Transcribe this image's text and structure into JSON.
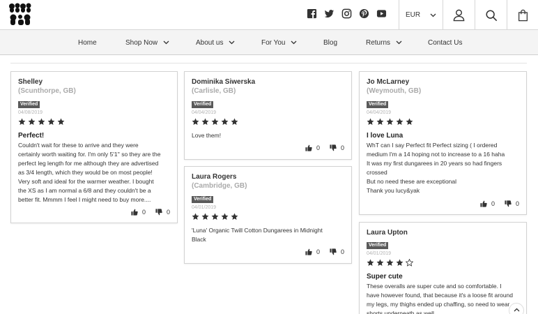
{
  "brand": {
    "logo_text": "lucy & yak"
  },
  "header": {
    "social": [
      "facebook-icon",
      "twitter-icon",
      "instagram-icon",
      "pinterest-icon",
      "youtube-icon"
    ],
    "currency": "EUR"
  },
  "nav": {
    "items": [
      {
        "label": "Home",
        "dropdown": false
      },
      {
        "label": "Shop Now",
        "dropdown": true
      },
      {
        "label": "About us",
        "dropdown": true
      },
      {
        "label": "For You",
        "dropdown": true
      },
      {
        "label": "Blog",
        "dropdown": false
      },
      {
        "label": "Returns",
        "dropdown": true
      },
      {
        "label": "Contact Us",
        "dropdown": false
      }
    ]
  },
  "verified_label": "Verified",
  "reviews": [
    {
      "name": "Shelley",
      "location": "(Scunthorpe, GB)",
      "date": "04/08/2019",
      "rating": 5,
      "title": "Perfect!",
      "body": "Couldn't wait for these to arrive and they were\ncertainly worth waiting for. I'm only 5'1'' so they are the\nperfect leg length for me although they are advertised\nas 3/4 length, which they would be on most people!\nVery soft and ideal for the warmer weather. I bought\nthe XS as I am normal a 6/8 and they couldn't be a\nbetter fit. Mmmm I feel I might need to buy more....",
      "helpful_yes": "0",
      "helpful_no": "0"
    },
    {
      "name": "Dominika Siwerska",
      "location": "(Carlisle, GB)",
      "date": "04/04/2019",
      "rating": 5,
      "title": "",
      "body": "Love them!",
      "helpful_yes": "0",
      "helpful_no": "0"
    },
    {
      "name": "Laura Rogers",
      "location": "(Cambridge, GB)",
      "date": "04/01/2019",
      "rating": 5,
      "title": "",
      "body": "'Luna' Organic Twill Cotton Dungarees in Midnight\nBlack",
      "helpful_yes": "0",
      "helpful_no": "0"
    },
    {
      "name": "Jo McLarney",
      "location": "(Weymouth, GB)",
      "date": "04/04/2019",
      "rating": 5,
      "title": "I love Luna",
      "body": "WhT can I say Perfect fit Perfect sizing ( I ordered\nmedium I'm a 14 hoping not to increase to a 16 haha\nIt was my first dungarees in 20 years so had fingers\ncrossed\nBut no need these are exceptional\nThank you lucy&yak",
      "helpful_yes": "0",
      "helpful_no": "0"
    },
    {
      "name": "Laura Upton",
      "location": "",
      "date": "04/01/2019",
      "rating": 4,
      "title": "Super cute",
      "body": "These overalls are super cute and so comfortable. I\nhave however found, that because it's a loose fit around\nmy legs, my thighs ended up chaffing, so need to wear\nshorts underneath as well.",
      "helpful_yes": "",
      "helpful_no": ""
    }
  ]
}
